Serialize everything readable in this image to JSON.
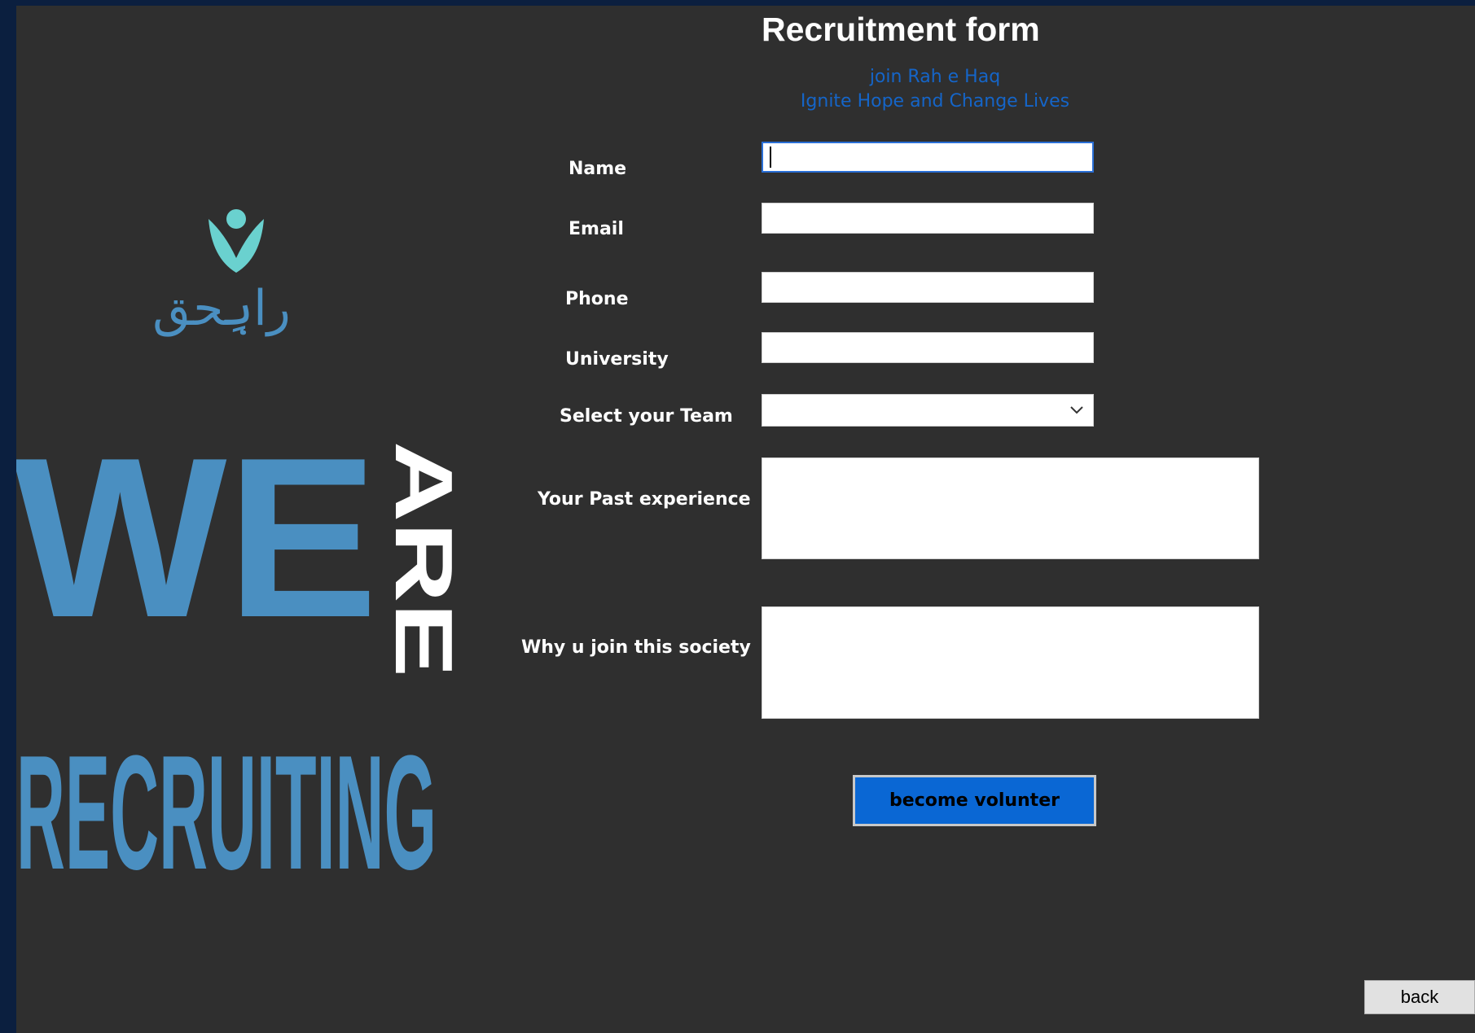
{
  "form": {
    "title": "Recruitment form",
    "tagline_line1": "join Rah e Haq",
    "tagline_line2": "Ignite Hope and Change Lives"
  },
  "fields": {
    "name_label": "Name",
    "email_label": "Email",
    "phone_label": "Phone",
    "university_label": "University",
    "team_label": "Select your Team",
    "experience_label": "Your Past experience",
    "reason_label": "Why u join this society",
    "name_value": "",
    "email_value": "",
    "phone_value": "",
    "university_value": "",
    "team_value": "",
    "experience_value": "",
    "reason_value": ""
  },
  "banner": {
    "logo_text": "راہِحق",
    "word_we": "WE",
    "word_are": "ARE",
    "word_recruiting": "RECRUITING"
  },
  "buttons": {
    "submit_label": "become volunter",
    "back_label": "back"
  },
  "colors": {
    "background": "#2f2f2f",
    "desktop": "#0b1f3f",
    "accent_blue": "#4a8fc1",
    "logo_teal": "#6ad1cf",
    "link_blue": "#1565c8",
    "button_blue": "#0a67d4"
  }
}
